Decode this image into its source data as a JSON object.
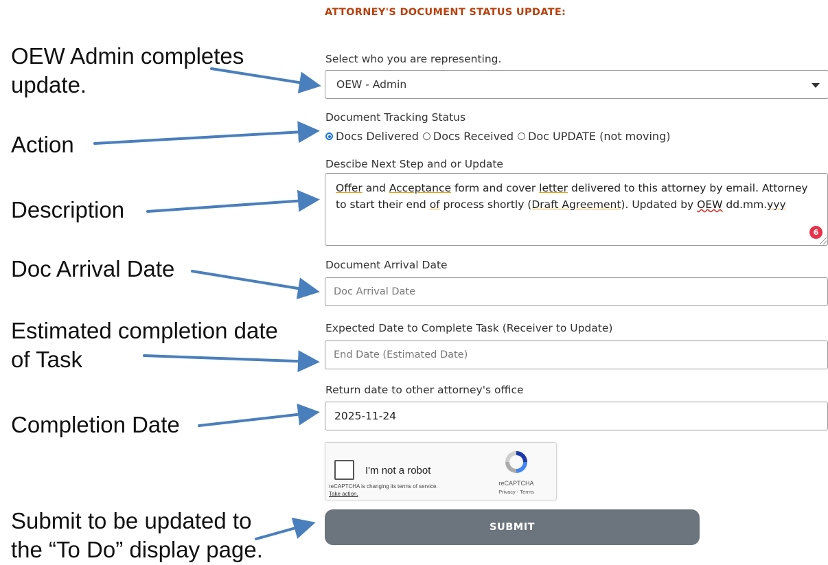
{
  "form": {
    "title": "ATTORNEY'S DOCUMENT STATUS UPDATE:",
    "representing": {
      "label": "Select who you are representing.",
      "value": "OEW - Admin"
    },
    "tracking": {
      "label": "Document Tracking Status",
      "options": [
        "Docs Delivered",
        "Docs Received",
        "Doc UPDATE (not moving)"
      ],
      "selected": "Docs Delivered"
    },
    "next_step": {
      "label": "Descibe Next Step and or Update",
      "text": {
        "w1": "Offer",
        "t1": " and ",
        "w2": "Acceptance",
        "t2": " form and cover ",
        "w3": "letter",
        "t3": " delivered to this attorney by email. Attorney to start their end ",
        "w4": "of",
        "t4": " process shortly (",
        "w5": "Draft Agreement",
        "t5": "). Updated by ",
        "w6": "OEW",
        "t6": " dd.mm.",
        "w7": "yyy"
      },
      "badge_count": "6"
    },
    "arrival": {
      "label": "Document Arrival Date",
      "placeholder": "Doc Arrival Date"
    },
    "expected": {
      "label": "Expected Date to Complete Task (Receiver to Update)",
      "placeholder": "End Date (Estimated Date)"
    },
    "return": {
      "label": "Return date to other attorney's office",
      "value": "2025-11-24"
    },
    "captcha": {
      "label": "I'm not a robot",
      "notice": "reCAPTCHA is changing its terms of service.",
      "notice_link": "Take action.",
      "brand": "reCAPTCHA",
      "links": "Privacy - Terms"
    },
    "submit_label": "SUBMIT"
  },
  "annotations": {
    "admin": [
      "OEW Admin completes",
      "update."
    ],
    "action": "Action",
    "description": "Description",
    "arrival": "Doc Arrival Date",
    "estimated": [
      "Estimated completion date",
      "of Task"
    ],
    "completion": "Completion Date",
    "submit": [
      "Submit to be updated to",
      "the “To Do” display page."
    ]
  },
  "colors": {
    "title": "#b7410e",
    "arrow": "#4a7fbd",
    "submit_bg": "#6c757d",
    "radio": "#1a73e8",
    "badge": "#e8324a"
  }
}
